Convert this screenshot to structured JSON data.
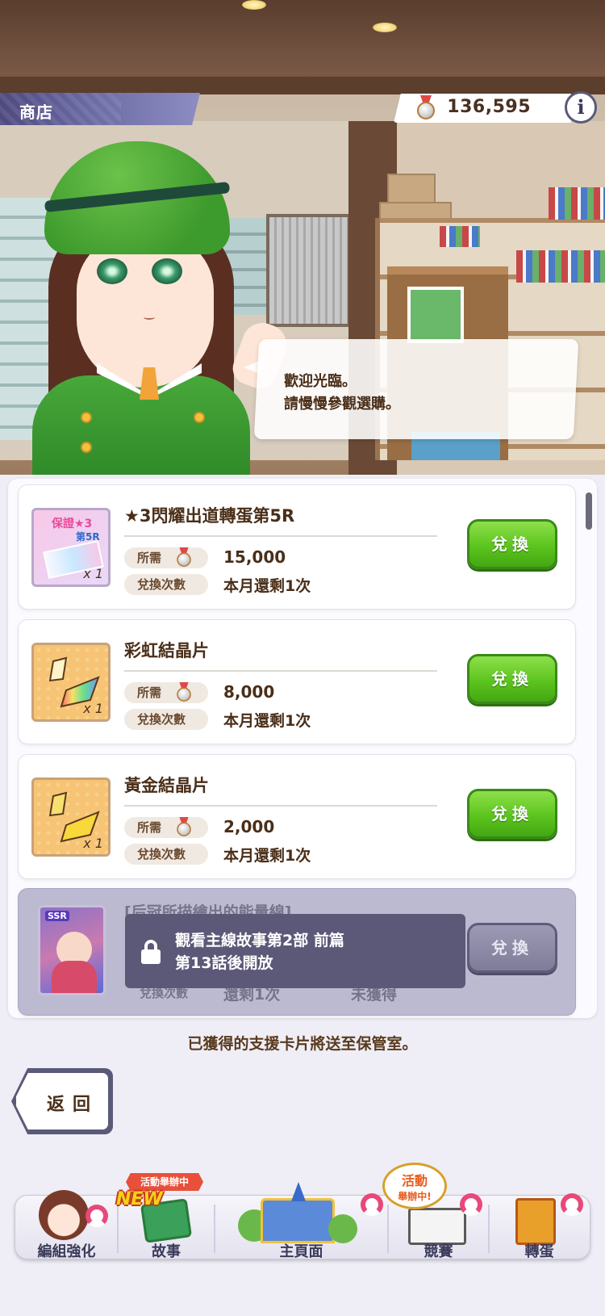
{
  "header": {
    "title": "商店",
    "currency_value": "136,595",
    "info_label": "i"
  },
  "dialog": {
    "line1": "歡迎光臨。",
    "line2": "請慢慢參觀選購。"
  },
  "items": [
    {
      "name": "★3閃耀出道轉蛋第5R",
      "required_label": "所需",
      "cost": "15,000",
      "count_label": "兌換次數",
      "remaining": "本月還剩1次",
      "button": "兌換",
      "thumb_text": "保證★3",
      "thumb_sub": "第5R",
      "qty": "x 1"
    },
    {
      "name": "彩虹結晶片",
      "required_label": "所需",
      "cost": "8,000",
      "count_label": "兌換次數",
      "remaining": "本月還剩1次",
      "button": "兌換",
      "qty": "x 1"
    },
    {
      "name": "黃金結晶片",
      "required_label": "所需",
      "cost": "2,000",
      "count_label": "兌換次數",
      "remaining": "本月還剩1次",
      "button": "兌換",
      "qty": "x 1"
    },
    {
      "name": "[后冠所描繪出的能量線]",
      "count_label": "兌換次數",
      "remaining": "還剩1次",
      "status": "未獲得",
      "button": "兌換",
      "thumb_text": "SSR",
      "locked_line1": "觀看主線故事第2部 前篇",
      "locked_line2": "第13話後開放"
    }
  ],
  "notice": "已獲得的支援卡片將送至保管室。",
  "back_button": "返回",
  "nav": {
    "items": [
      {
        "label": "編組強化"
      },
      {
        "label": "故事",
        "badge_ribbon": "活動舉辦中",
        "badge_new": "NEW"
      },
      {
        "label": "主頁面"
      },
      {
        "label": "競賽",
        "badge_line1": "活動",
        "badge_line2": "舉辦中!"
      },
      {
        "label": "轉蛋"
      }
    ]
  },
  "colors": {
    "accent_green": "#5cc41e",
    "title_bar": "#6b6aa3",
    "text_brown": "#4a2e18",
    "locked_overlay": "#5c5878"
  }
}
